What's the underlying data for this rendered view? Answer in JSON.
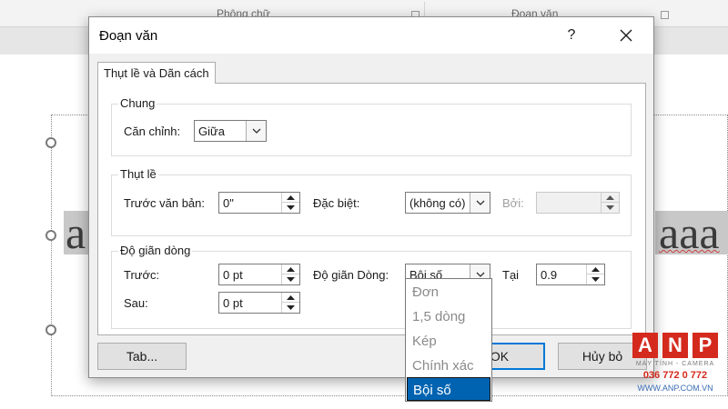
{
  "ribbon": {
    "groups": [
      {
        "label": "Phông chữ"
      },
      {
        "label": "Đoạn văn"
      }
    ]
  },
  "slide": {
    "text_left": "a",
    "text_right": "aaa"
  },
  "dialog": {
    "title": "Đoạn văn",
    "help_glyph": "?",
    "tab_label": "Thụt lề và Dãn cách",
    "general": {
      "title": "Chung",
      "alignment_label": "Căn chỉnh:",
      "alignment_value": "Giữa"
    },
    "indent": {
      "title": "Thụt lề",
      "before_text_label": "Trước văn bản:",
      "before_text_value": "0\"",
      "special_label": "Đặc biệt:",
      "special_value": "(không có)",
      "by_label": "Bởi:",
      "by_value": ""
    },
    "spacing": {
      "title": "Độ giãn dòng",
      "before_label": "Trước:",
      "before_value": "0 pt",
      "after_label": "Sau:",
      "after_value": "0 pt",
      "line_spacing_label": "Độ giãn Dòng:",
      "line_spacing_value": "Bội số",
      "at_label": "Tại",
      "at_value": "0.9"
    },
    "buttons": {
      "tabs": "Tab...",
      "ok": "OK",
      "cancel": "Hủy bỏ"
    },
    "line_spacing_options": [
      {
        "label": "Đơn",
        "selected": false
      },
      {
        "label": "1,5 dòng",
        "selected": false
      },
      {
        "label": "Kép",
        "selected": false
      },
      {
        "label": "Chính xác",
        "selected": false
      },
      {
        "label": "Bội số",
        "selected": true
      }
    ]
  },
  "watermark": {
    "letters": [
      "A",
      "N",
      "P"
    ],
    "tagline": "MÁY TÍNH - CAMERA",
    "phone": "036 772 0 772",
    "site": "WWW.ANP.COM.VN"
  },
  "colors": {
    "selection": "#0063b1",
    "default_button_border": "#0078d7",
    "watermark_red": "#d42a1e",
    "watermark_blue": "#2f6db5"
  }
}
